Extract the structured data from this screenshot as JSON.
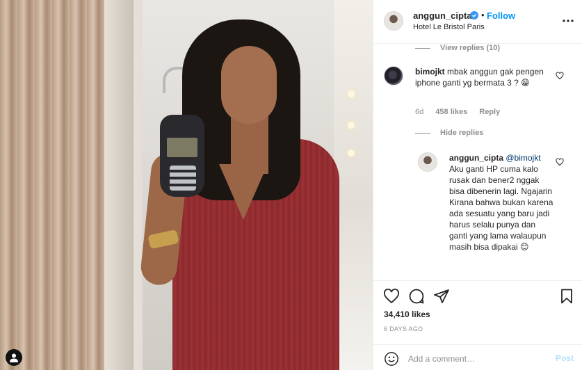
{
  "post": {
    "username": "anggun_cipta",
    "follow_label": "Follow",
    "dot": "•",
    "location": "Hotel Le Bristol Paris",
    "photo_alt": "Woman in red dress holding an old mobile phone in front of a mirror"
  },
  "comments": {
    "view_replies_label": "View replies (10)",
    "items": [
      {
        "username": "bimojkt",
        "text": "mbak anggun gak pengen iphone ganti yg bermata 3 ? 😁",
        "age": "6d",
        "likes": "458 likes",
        "reply_label": "Reply",
        "hide_replies_label": "Hide replies"
      }
    ],
    "reply": {
      "username": "anggun_cipta",
      "mention": "@bimojkt",
      "text": "Aku ganti HP cuma kalo rusak dan bener2 nggak bisa dibenerin lagi. Ngajarin Kirana bahwa bukan karena ada sesuatu yang baru jadi harus selalu punya dan ganti yang lama walaupun masih bisa dipakai 😊"
    }
  },
  "actions": {
    "likes": "34,410 likes",
    "time": "6 DAYS AGO"
  },
  "add_comment": {
    "placeholder": "Add a comment…",
    "post_label": "Post"
  },
  "colors": {
    "accent": "#0095f6",
    "verified": "#3897f0",
    "post_disabled": "#b2dffc"
  }
}
